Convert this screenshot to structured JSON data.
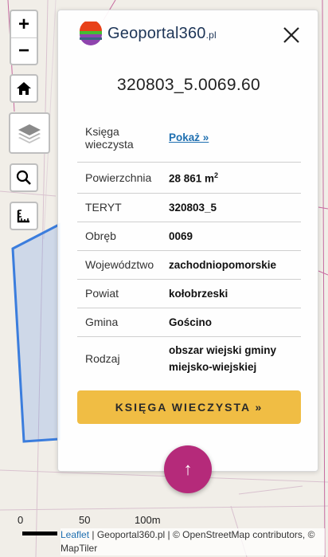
{
  "controls": {
    "zoom_in": "+",
    "zoom_out": "−"
  },
  "card": {
    "brand_name": "Geoportal",
    "brand_num": "360",
    "brand_tld": ".pl",
    "parcel_id": "320803_5.0069.60",
    "rows": [
      {
        "label": "Księga wieczysta",
        "value": "Pokaż »"
      },
      {
        "label": "Powierzchnia",
        "value": "28 861 m",
        "sup": "2"
      },
      {
        "label": "TERYT",
        "value": "320803_5"
      },
      {
        "label": "Obręb",
        "value": "0069"
      },
      {
        "label": "Województwo",
        "value": "zachodniopomorskie"
      },
      {
        "label": "Powiat",
        "value": "kołobrzeski"
      },
      {
        "label": "Gmina",
        "value": "Gościno"
      },
      {
        "label": "Rodzaj",
        "value": "obszar wiejski gminy miejsko-wiejskiej"
      }
    ],
    "kw_button": "KSIĘGA WIECZYSTA »"
  },
  "fab_icon": "↑",
  "scale": {
    "labels": [
      "0",
      "50",
      "100m"
    ]
  },
  "attribution": {
    "leaflet": "Leaflet",
    "rest": " | Geoportal360.pl | © OpenStreetMap contributors, © MapTiler"
  },
  "colors": {
    "accent": "#f0bd44",
    "fab": "#b52a7a",
    "parcel_stroke": "#3b7ddd",
    "link": "#1e6fb0"
  }
}
